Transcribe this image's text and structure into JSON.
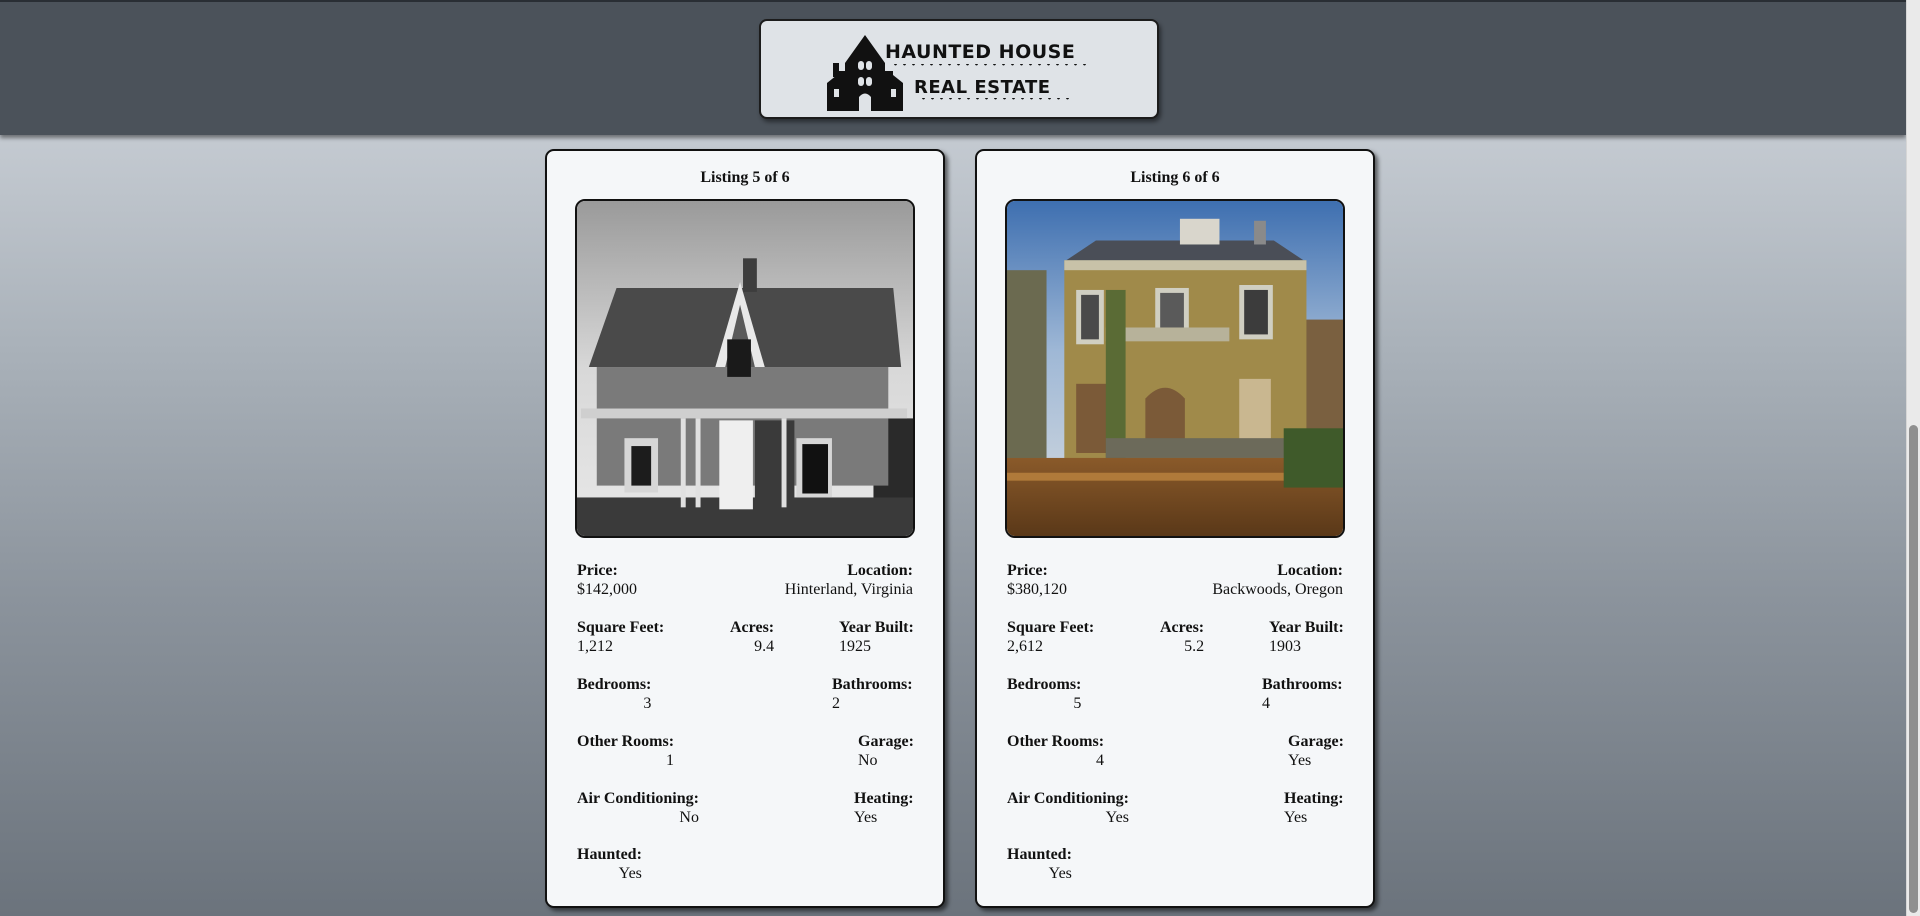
{
  "header": {
    "logo_line1": "HAUNTED HOUSE",
    "logo_line2": "REAL ESTATE"
  },
  "labels": {
    "price": "Price:",
    "location": "Location:",
    "square_feet": "Square Feet:",
    "acres": "Acres:",
    "year_built": "Year Built:",
    "bedrooms": "Bedrooms:",
    "bathrooms": "Bathrooms:",
    "other_rooms": "Other Rooms:",
    "garage": "Garage:",
    "air_conditioning": "Air Conditioning:",
    "heating": "Heating:",
    "haunted": "Haunted:"
  },
  "listings": [
    {
      "title": "Listing 5 of 6",
      "price": "$142,000",
      "location": "Hinterland, Virginia",
      "square_feet": "1,212",
      "acres": "9.4",
      "year_built": "1925",
      "bedrooms": "3",
      "bathrooms": "2",
      "other_rooms": "1",
      "garage": "No",
      "air_conditioning": "No",
      "heating": "Yes",
      "haunted": "Yes"
    },
    {
      "title": "Listing 6 of 6",
      "price": "$380,120",
      "location": "Backwoods, Oregon",
      "square_feet": "2,612",
      "acres": "5.2",
      "year_built": "1903",
      "bedrooms": "5",
      "bathrooms": "4",
      "other_rooms": "4",
      "garage": "Yes",
      "air_conditioning": "Yes",
      "heating": "Yes",
      "haunted": "Yes"
    }
  ]
}
